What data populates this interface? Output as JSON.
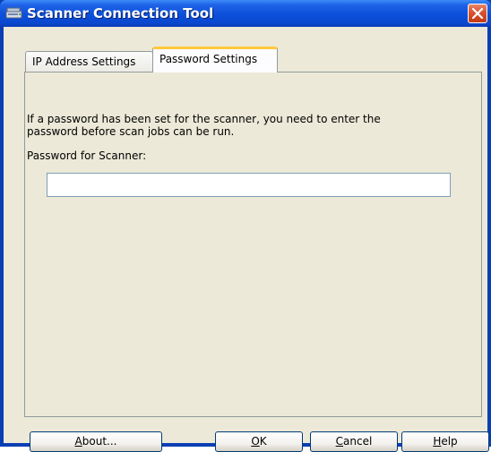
{
  "window": {
    "title": "Scanner Connection Tool",
    "icon": "scanner-icon",
    "close_icon": "close-icon"
  },
  "tabs": [
    {
      "label": "IP Address Settings",
      "selected": false
    },
    {
      "label": "Password Settings",
      "selected": true
    }
  ],
  "panel": {
    "description": "If a password has been set for the scanner, you need to enter the\npassword before scan jobs can be run.",
    "password_label": "Password for Scanner:",
    "password_value": ""
  },
  "buttons": {
    "about": {
      "mnemonic": "A",
      "rest": "bout..."
    },
    "ok": {
      "mnemonic": "O",
      "rest": "K"
    },
    "cancel": {
      "mnemonic": "C",
      "rest": "ancel"
    },
    "help": {
      "mnemonic": "H",
      "rest": "elp"
    }
  },
  "colors": {
    "titlebar": "#0b4fd9",
    "dialog_bg": "#ece9d8",
    "selected_tab_accent": "#ffc83c",
    "close_button": "#d9532f"
  }
}
